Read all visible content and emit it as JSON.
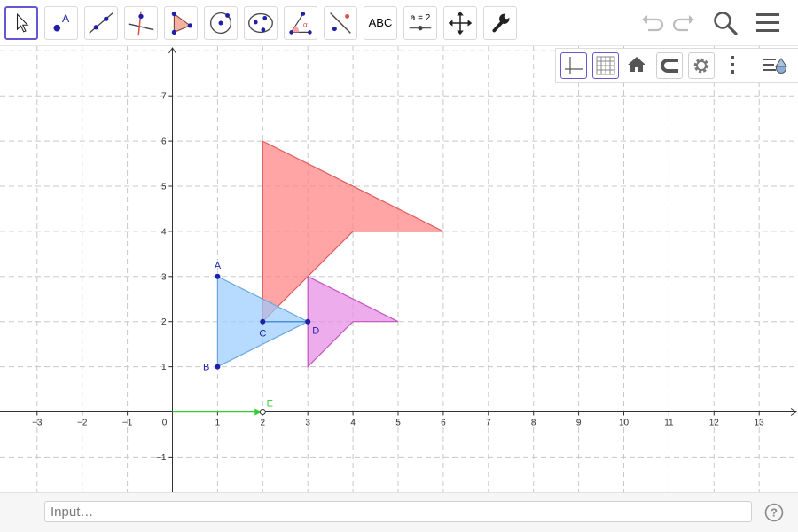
{
  "toolbar": {
    "tools": [
      {
        "name": "move-tool-button",
        "label": "",
        "selected": true
      },
      {
        "name": "point-tool-button",
        "label": "A"
      },
      {
        "name": "line-tool-button",
        "label": ""
      },
      {
        "name": "perpendicular-line-tool-button",
        "label": ""
      },
      {
        "name": "polygon-tool-button",
        "label": ""
      },
      {
        "name": "circle-tool-button",
        "label": ""
      },
      {
        "name": "ellipse-tool-button",
        "label": ""
      },
      {
        "name": "angle-tool-button",
        "label": "α"
      },
      {
        "name": "reflect-tool-button",
        "label": ""
      },
      {
        "name": "text-tool-button",
        "label": "ABC"
      },
      {
        "name": "slider-tool-button",
        "label": "a = 2"
      },
      {
        "name": "move-graphics-view-tool-button",
        "label": ""
      },
      {
        "name": "tools-settings-button",
        "label": ""
      }
    ],
    "icons": [
      "undo-icon",
      "redo-icon",
      "search-icon",
      "menu-icon"
    ]
  },
  "style_bar": {
    "buttons": [
      "show-axes-button",
      "show-grid-button",
      "standard-view-button",
      "point-capturing-button",
      "graphics-settings-button",
      "more-options-button",
      "toggle-style-bar-button"
    ]
  },
  "graphics": {
    "x_ticks": [
      "−3",
      "−2",
      "−1",
      "0",
      "1",
      "2",
      "3",
      "4",
      "5",
      "6",
      "7",
      "8",
      "9",
      "10",
      "11",
      "12",
      "13"
    ],
    "y_ticks": [
      "−1",
      "1",
      "2",
      "3",
      "4",
      "5",
      "6",
      "7"
    ],
    "points": {
      "A": {
        "label": "A",
        "x": 1,
        "y": 3
      },
      "B": {
        "label": "B",
        "x": 1,
        "y": 1
      },
      "C": {
        "label": "C",
        "x": 2,
        "y": 2
      },
      "D": {
        "label": "D",
        "x": 3,
        "y": 2
      },
      "E": {
        "label": "E",
        "x": 2,
        "y": 0
      }
    },
    "colors": {
      "blue_polygon": "#99ccff",
      "red_polygon": "#ff7f7f",
      "magenta_polygon": "#e58ae5",
      "point": "#1f1fa8",
      "vector": "#33cc33"
    }
  },
  "input": {
    "placeholder": "Input…"
  }
}
